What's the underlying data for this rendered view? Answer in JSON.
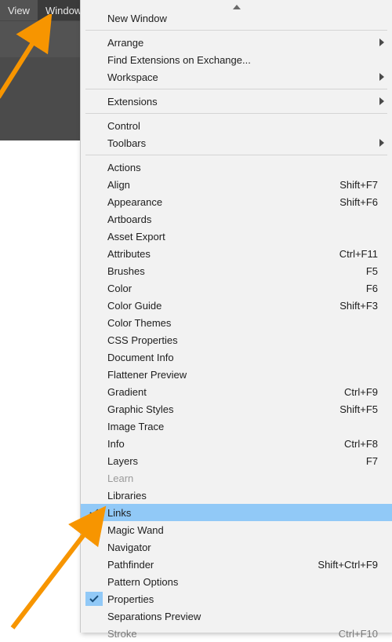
{
  "menubar": {
    "items": [
      {
        "label": "View",
        "active": false
      },
      {
        "label": "Window",
        "active": true
      }
    ]
  },
  "dropdown": {
    "groups": [
      [
        {
          "label": "New Window"
        }
      ],
      [
        {
          "label": "Arrange",
          "submenu": true
        },
        {
          "label": "Find Extensions on Exchange..."
        },
        {
          "label": "Workspace",
          "submenu": true
        }
      ],
      [
        {
          "label": "Extensions",
          "submenu": true
        }
      ],
      [
        {
          "label": "Control"
        },
        {
          "label": "Toolbars",
          "submenu": true
        }
      ],
      [
        {
          "label": "Actions"
        },
        {
          "label": "Align",
          "shortcut": "Shift+F7"
        },
        {
          "label": "Appearance",
          "shortcut": "Shift+F6"
        },
        {
          "label": "Artboards"
        },
        {
          "label": "Asset Export"
        },
        {
          "label": "Attributes",
          "shortcut": "Ctrl+F11"
        },
        {
          "label": "Brushes",
          "shortcut": "F5"
        },
        {
          "label": "Color",
          "shortcut": "F6"
        },
        {
          "label": "Color Guide",
          "shortcut": "Shift+F3"
        },
        {
          "label": "Color Themes"
        },
        {
          "label": "CSS Properties"
        },
        {
          "label": "Document Info"
        },
        {
          "label": "Flattener Preview"
        },
        {
          "label": "Gradient",
          "shortcut": "Ctrl+F9"
        },
        {
          "label": "Graphic Styles",
          "shortcut": "Shift+F5"
        },
        {
          "label": "Image Trace"
        },
        {
          "label": "Info",
          "shortcut": "Ctrl+F8"
        },
        {
          "label": "Layers",
          "shortcut": "F7"
        },
        {
          "label": "Learn",
          "disabled": true
        },
        {
          "label": "Libraries"
        },
        {
          "label": "Links",
          "checked": true,
          "highlight": true
        },
        {
          "label": "Magic Wand"
        },
        {
          "label": "Navigator"
        },
        {
          "label": "Pathfinder",
          "shortcut": "Shift+Ctrl+F9"
        },
        {
          "label": "Pattern Options"
        },
        {
          "label": "Properties",
          "checked": true
        },
        {
          "label": "Separations Preview"
        },
        {
          "label": "Stroke",
          "shortcut": "Ctrl+F10",
          "truncated": true
        }
      ]
    ]
  },
  "annotations": {
    "arrow_color": "#f79500"
  }
}
